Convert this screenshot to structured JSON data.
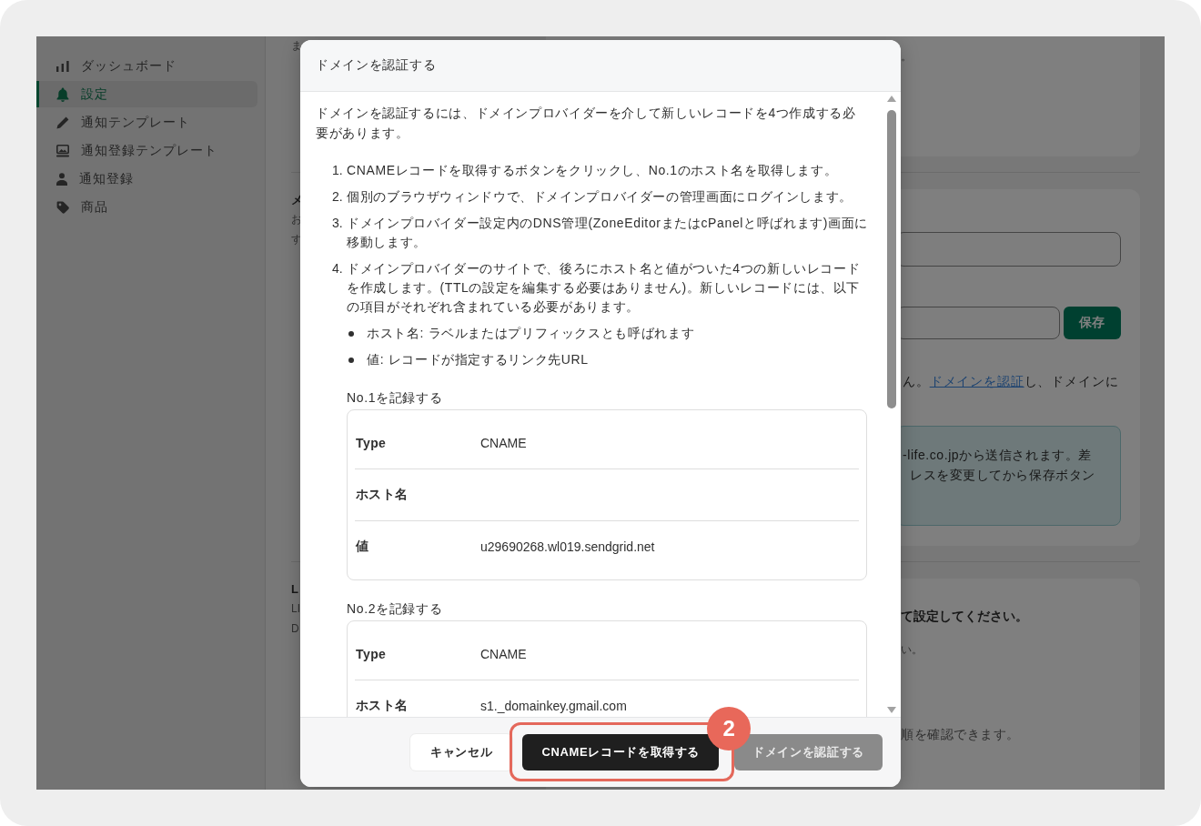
{
  "sidebar": {
    "items": [
      {
        "label": "ダッシュボード",
        "selected": false
      },
      {
        "label": "設定",
        "selected": true
      },
      {
        "label": "通知テンプレート",
        "selected": false
      },
      {
        "label": "通知登録テンプレート",
        "selected": false
      },
      {
        "label": "通知登録",
        "selected": false
      },
      {
        "label": "商品",
        "selected": false
      }
    ]
  },
  "settings": {
    "section_1": {
      "description": "ま",
      "card_note": "。"
    },
    "section_2": {
      "title": "メ",
      "description": [
        "お",
        "す"
      ],
      "save_button": "保存",
      "domain_notice": {
        "before": "ん。",
        "link": "ドメインを認証",
        "after": "し、ドメインに"
      },
      "info_box": [
        "-life.co.jpから送信されます。差",
        "レスを変更してから保存ボタン"
      ]
    },
    "section_3": {
      "title": "L",
      "description": [
        "LI",
        "D"
      ],
      "card_heading": "て設定してください。",
      "card_hint": "い。",
      "card_help": "順を確認できます。"
    }
  },
  "dialog": {
    "title": "ドメインを認証する",
    "intro": "ドメインを認証するには、ドメインプロバイダーを介して新しいレコードを4つ作成する必要があります。",
    "steps": [
      {
        "number": "1.",
        "text": "CNAMEレコードを取得するボタンをクリックし、No.1のホスト名を取得します。"
      },
      {
        "number": "2.",
        "text": "個別のブラウザウィンドウで、ドメインプロバイダーの管理画面にログインします。"
      },
      {
        "number": "3.",
        "text": "ドメインプロバイダー設定内のDNS管理(ZoneEditorまたはcPanelと呼ばれます)画面に移動します。"
      },
      {
        "number": "4.",
        "text": "ドメインプロバイダーのサイトで、後ろにホスト名と値がついた4つの新しいレコードを作成します。(TTLの設定を編集する必要はありません)。新しいレコードには、以下の項目がそれぞれ含まれている必要があります。",
        "bullets": [
          "ホスト名: ラベルまたはプリフィックスとも呼ばれます",
          "値: レコードが指定するリンク先URL"
        ]
      }
    ],
    "records": [
      {
        "title": "No.1を記録する",
        "rows": [
          {
            "label": "Type",
            "value": "CNAME"
          },
          {
            "label": "ホスト名"
          },
          {
            "label": "値",
            "value": "u29690268.wl019.sendgrid.net"
          }
        ]
      },
      {
        "title": "No.2を記録する",
        "rows": [
          {
            "label": "Type",
            "value": "CNAME"
          },
          {
            "label": "ホスト名",
            "value": "s1._domainkey.gmail.com"
          }
        ]
      }
    ],
    "buttons": [
      {
        "label": "キャンセル",
        "kind": "secondary",
        "disabled": false,
        "highlighted": false
      },
      {
        "label": "CNAMEレコードを取得する",
        "kind": "primary",
        "disabled": false,
        "highlighted": true
      },
      {
        "label": "ドメインを認証する",
        "kind": "primary",
        "disabled": true,
        "highlighted": false
      }
    ]
  },
  "annotation": {
    "step": "2"
  }
}
